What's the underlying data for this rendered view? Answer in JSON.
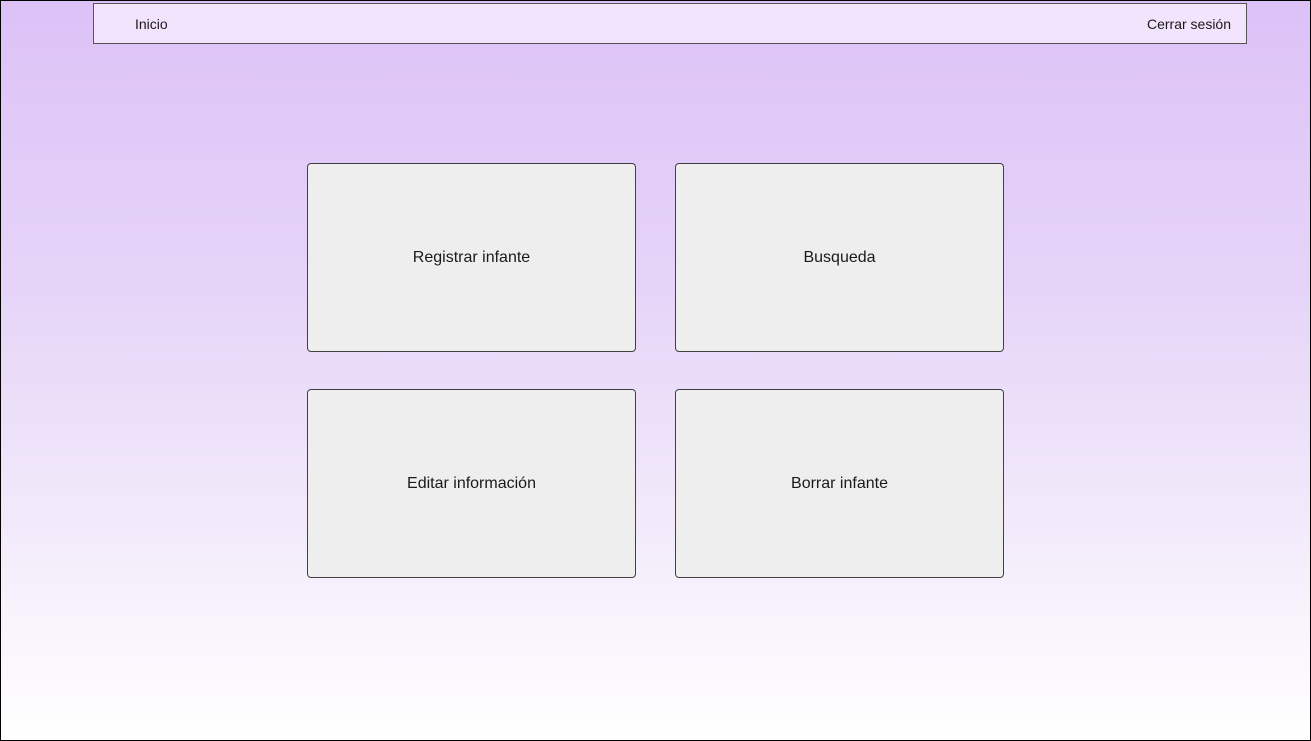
{
  "navbar": {
    "home_label": "Inicio",
    "logout_label": "Cerrar sesión"
  },
  "menu": {
    "register": "Registrar infante",
    "search": "Busqueda",
    "edit": "Editar información",
    "delete": "Borrar infante"
  },
  "colors": {
    "gradient_top": "#dcc1f7",
    "gradient_bottom": "#ffffff",
    "navbar_bg": "#f1e4fc",
    "tile_bg": "#eeeeee"
  }
}
